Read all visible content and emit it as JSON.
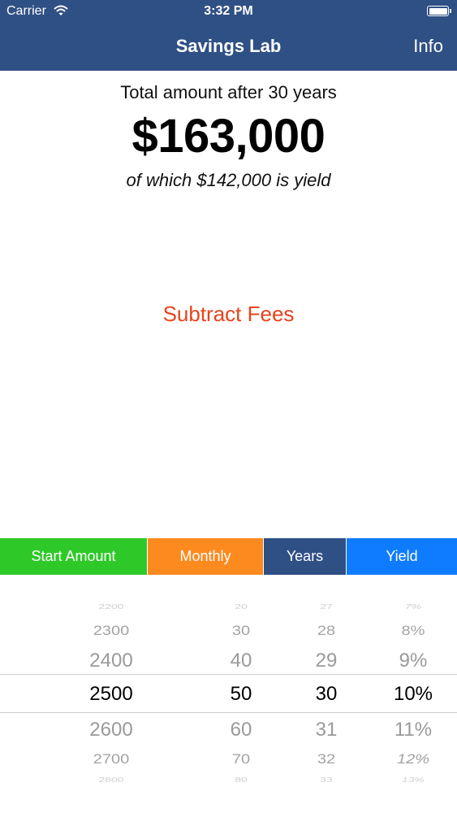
{
  "status_bar": {
    "carrier": "Carrier",
    "time": "3:32 PM"
  },
  "nav": {
    "title": "Savings Lab",
    "info_label": "Info"
  },
  "summary": {
    "label": "Total amount after 30 years",
    "total": "$163,000",
    "yield_note": "of which $142,000 is yield"
  },
  "subtract_fees_label": "Subtract Fees",
  "tabs": [
    {
      "label": "Start Amount",
      "color": "#2ec929"
    },
    {
      "label": "Monthly",
      "color": "#fc8a1f"
    },
    {
      "label": "Years",
      "color": "#2f5085"
    },
    {
      "label": "Yield",
      "color": "#0f7cff"
    }
  ],
  "picker": {
    "columns": [
      {
        "name": "start-amount",
        "values": [
          "2200",
          "2300",
          "2400",
          "2500",
          "2600",
          "2700",
          "2800"
        ]
      },
      {
        "name": "monthly",
        "values": [
          "20",
          "30",
          "40",
          "50",
          "60",
          "70",
          "80"
        ]
      },
      {
        "name": "years",
        "values": [
          "27",
          "28",
          "29",
          "30",
          "31",
          "32",
          "33"
        ]
      },
      {
        "name": "yield",
        "values": [
          "7%",
          "8%",
          "9%",
          "10%",
          "11%",
          "12%",
          "13%"
        ]
      }
    ],
    "selected_index": 3
  }
}
